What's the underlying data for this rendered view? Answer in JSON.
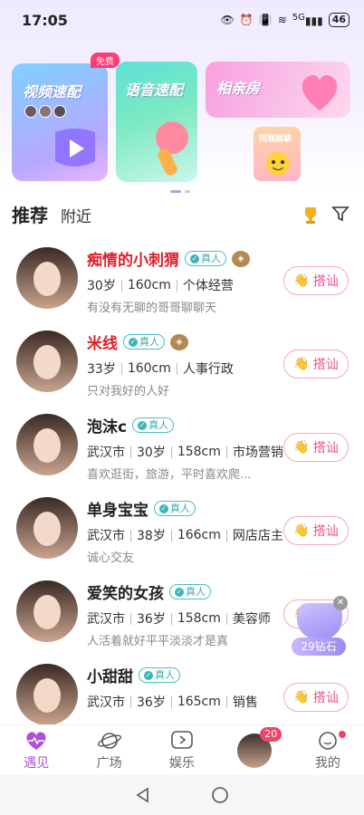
{
  "status": {
    "time": "17:05",
    "battery": "46",
    "signal": "5G"
  },
  "banners": {
    "video": "视频速配",
    "voice": "语音速配",
    "blind": "相亲房",
    "city": "同城群聊",
    "free_tag": "免费"
  },
  "tabs": {
    "recommend": "推荐",
    "nearby": "附近"
  },
  "verify_label": "真人",
  "greet_label": "搭讪",
  "users": [
    {
      "name": "痴情的小刺猬",
      "name_red": true,
      "medal": true,
      "info": [
        "30岁",
        "160cm",
        "个体经营"
      ],
      "signature": "有没有无聊的哥哥聊聊天"
    },
    {
      "name": "米线",
      "name_red": true,
      "medal": true,
      "info": [
        "33岁",
        "160cm",
        "人事行政"
      ],
      "signature": "只对我好的人好"
    },
    {
      "name": "泡沫c",
      "name_red": false,
      "medal": false,
      "info": [
        "武汉市",
        "30岁",
        "158cm",
        "市场营销"
      ],
      "signature": "喜欢逛街，旅游，平时喜欢爬..."
    },
    {
      "name": "单身宝宝",
      "name_red": false,
      "medal": false,
      "info": [
        "武汉市",
        "38岁",
        "166cm",
        "网店店主"
      ],
      "signature": "诚心交友"
    },
    {
      "name": "爱笑的女孩",
      "name_red": false,
      "medal": false,
      "info": [
        "武汉市",
        "36岁",
        "158cm",
        "美容师"
      ],
      "signature": "人活着就好平平淡淡才是真"
    },
    {
      "name": "小甜甜",
      "name_red": false,
      "medal": false,
      "info": [
        "武汉市",
        "36岁",
        "165cm",
        "销售"
      ],
      "signature": ""
    }
  ],
  "floating": {
    "label": "29钻石"
  },
  "nav": [
    {
      "label": "遇见",
      "active": true
    },
    {
      "label": "广场"
    },
    {
      "label": "娱乐"
    },
    {
      "label": "",
      "badge": "20"
    },
    {
      "label": "我的"
    }
  ],
  "colors": {
    "accent": "#b04fdc",
    "name_red": "#e0202a",
    "greet_pink": "#ee4f8e",
    "verify_teal": "#3ab6b9"
  }
}
